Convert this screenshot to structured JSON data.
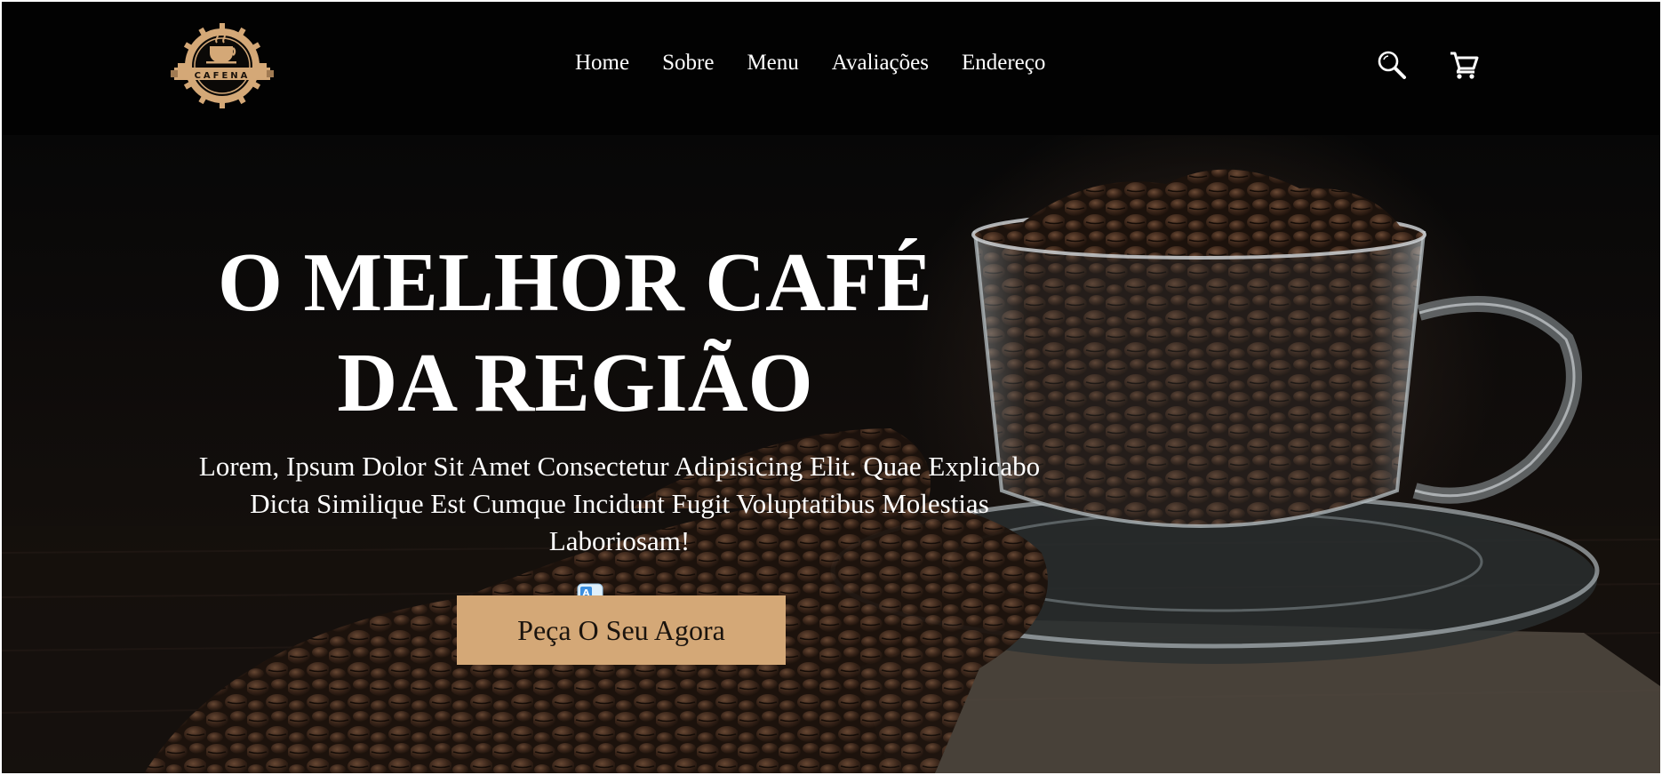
{
  "brand": {
    "logo_text": "CAFENA"
  },
  "nav": {
    "items": [
      {
        "label": "Home"
      },
      {
        "label": "Sobre"
      },
      {
        "label": "Menu"
      },
      {
        "label": "Avaliações"
      },
      {
        "label": "Endereço"
      }
    ]
  },
  "header": {
    "search_icon": "search-icon",
    "cart_icon": "cart-icon"
  },
  "hero": {
    "title_line1": "O MELHOR CAFÉ",
    "title_line2": "DA REGIÃO",
    "description": "Lorem, Ipsum Dolor Sit Amet Consectetur Adipisicing Elit. Quae Explicabo Dicta Similique Est Cumque Incidunt Fugit Voluptatibus Molestias Laboriosam!",
    "cta_label": "Peça O Seu Agora"
  },
  "colors": {
    "background": "#050505",
    "accent": "#d4a877",
    "text": "#ffffff"
  }
}
